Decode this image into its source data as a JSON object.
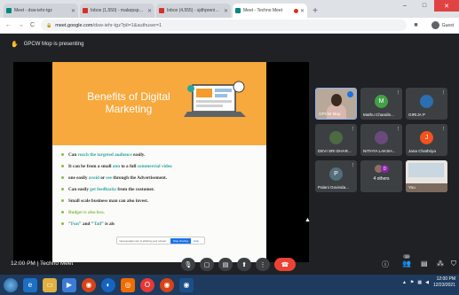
{
  "browser": {
    "tabs": [
      {
        "title": "Meet - dsw-iehr-tgz",
        "favicon_color": "#00897b"
      },
      {
        "title": "Inbox (1,550) - malarpspc@gma",
        "favicon_color": "#d93025"
      },
      {
        "title": "Inbox (4,555) - sjdhpreniasasd1",
        "favicon_color": "#d93025"
      },
      {
        "title": "Meet - Techno Meet",
        "favicon_color": "#00897b"
      }
    ],
    "new_tab": "+",
    "url_domain": "meet.google.com",
    "url_path": "/dsw-iehr-tgz?pli=1&authuser=1",
    "profile_label": "Guest"
  },
  "meet": {
    "presenting_label": "GPCW Mop is presenting",
    "slide": {
      "title": "Benefits of Digital Marketing",
      "bullets": [
        {
          "parts": [
            {
              "t": "Can ",
              "c": ""
            },
            {
              "t": "reach the targeted audience",
              "c": "hl"
            },
            {
              "t": " easily.",
              "c": ""
            }
          ]
        },
        {
          "parts": [
            {
              "t": "It can be from a small ",
              "c": ""
            },
            {
              "t": "ann",
              "c": "hl"
            },
            {
              "t": " to a full ",
              "c": ""
            },
            {
              "t": "commercial video",
              "c": "hl"
            }
          ]
        },
        {
          "parts": [
            {
              "t": "one easily ",
              "c": ""
            },
            {
              "t": "avoid",
              "c": "hl"
            },
            {
              "t": " or ",
              "c": ""
            },
            {
              "t": "see",
              "c": "hl"
            },
            {
              "t": " through the Advertisement.",
              "c": ""
            }
          ]
        },
        {
          "parts": [
            {
              "t": "Can easily ",
              "c": ""
            },
            {
              "t": "get feedbacks",
              "c": "hl"
            },
            {
              "t": " from the customer.",
              "c": ""
            }
          ]
        },
        {
          "parts": [
            {
              "t": "Small scale business man can also invest.",
              "c": ""
            }
          ]
        },
        {
          "parts": [
            {
              "t": "Budget is also less.",
              "c": "hl2"
            }
          ]
        },
        {
          "parts": [
            {
              "t": "\"",
              "c": ""
            },
            {
              "t": "Fun",
              "c": "hl"
            },
            {
              "t": "\" and \"",
              "c": ""
            },
            {
              "t": "Tail",
              "c": "hl"
            },
            {
              "t": "\" is als",
              "c": ""
            }
          ]
        }
      ],
      "notification_text": "meet.google.com is sharing your screen.",
      "stop_sharing_label": "Stop sharing",
      "hide_label": "Hide"
    },
    "participants": [
      {
        "name": "GPCW Mop",
        "kind": "camera",
        "active": true
      },
      {
        "name": "Mathu Chandin...",
        "initial": "M",
        "color": "#43a047",
        "kind": "initial"
      },
      {
        "name": "GIRIJA P",
        "kind": "photo"
      },
      {
        "name": "DEVI SRI DHAR...",
        "kind": "photo"
      },
      {
        "name": "NITHYA LAKSH...",
        "kind": "photo"
      },
      {
        "name": "Jana Chathriya",
        "initial": "J",
        "color": "#f4511e",
        "kind": "initial"
      },
      {
        "name": "Palani Govinda...",
        "initial": "P",
        "color": "#546e7a",
        "kind": "initial"
      },
      {
        "name": "4 others",
        "kind": "others",
        "initial": "D"
      },
      {
        "name": "You",
        "kind": "room"
      }
    ],
    "bottom": {
      "time": "12:00 PM",
      "separator": "|",
      "meeting_name": "Techno Meet",
      "people_count": "13"
    }
  },
  "taskbar": {
    "time": "12:00 PM",
    "date": "12/23/2021"
  }
}
